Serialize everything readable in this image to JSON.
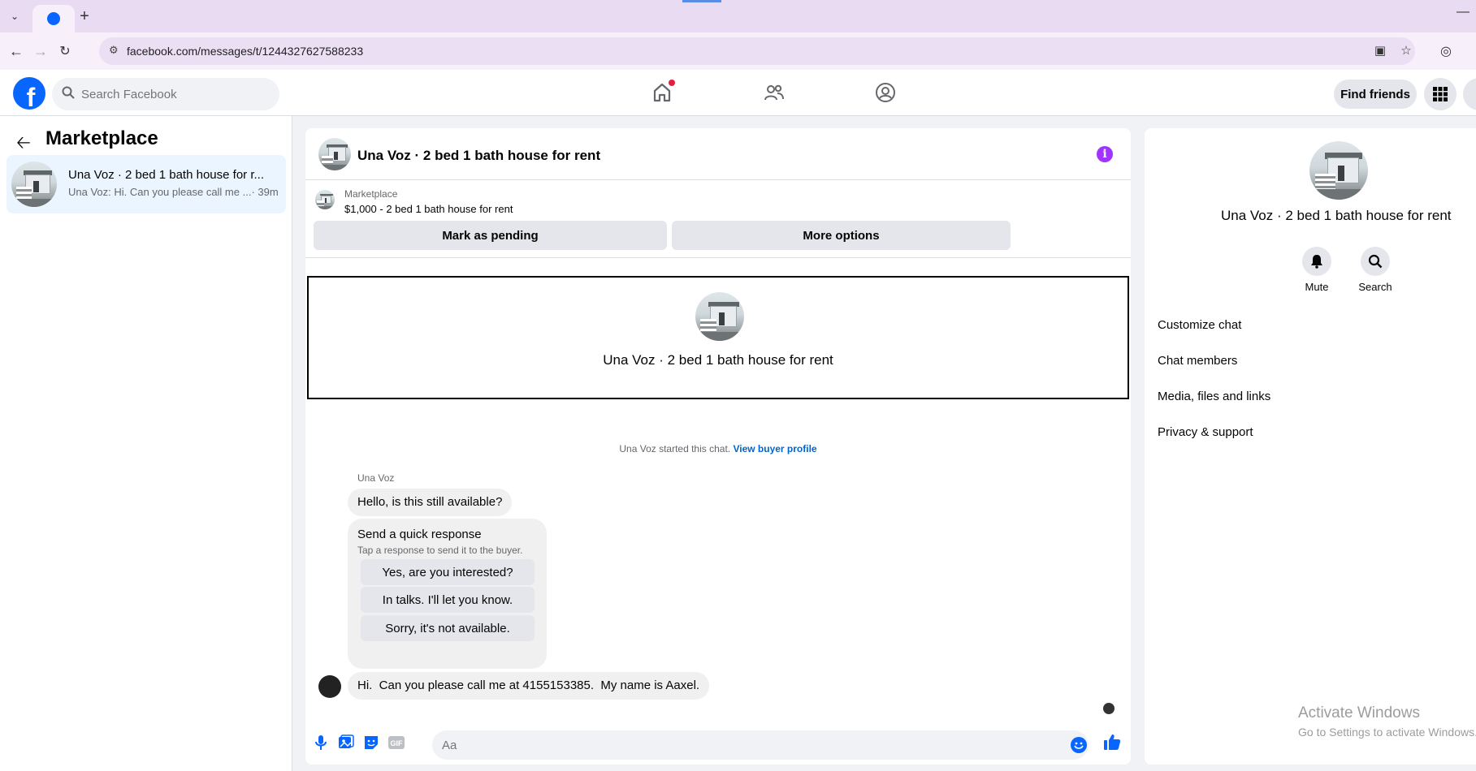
{
  "browser": {
    "url": "facebook.com/messages/t/1244327627588233"
  },
  "fb_header": {
    "search_placeholder": "Search Facebook",
    "find_friends": "Find friends"
  },
  "sidebar": {
    "title": "Marketplace",
    "conversation": {
      "name": "Una Voz · 2 bed 1 bath house for r...",
      "preview": "Una Voz: Hi.  Can you please call me ...",
      "time": "· 39m"
    }
  },
  "chat": {
    "header_title": "Una Voz · 2 bed 1 bath house for rent",
    "listing": {
      "label": "Marketplace",
      "price_title": "$1,000 - 2 bed 1 bath house for rent",
      "mark_pending": "Mark as pending",
      "more_options": "More options"
    },
    "intro_name": "Una Voz · 2 bed 1 bath house for rent",
    "started_text": "Una Voz started this chat. ",
    "started_link": "View buyer profile",
    "sender_name": "Una Voz",
    "message_1": "Hello, is this still available?",
    "quick_response": {
      "title": "Send a quick response",
      "subtitle": "Tap a response to send it to the buyer.",
      "options": [
        "Yes, are you interested?",
        "In talks. I'll let you know.",
        "Sorry, it's not available."
      ]
    },
    "message_2": "Hi.  Can you please call me at 4155153385.  My name is Aaxel.",
    "composer_placeholder": "Aa"
  },
  "info_panel": {
    "title": "Una Voz · 2 bed 1 bath house for rent",
    "actions": [
      "Mute",
      "Search"
    ],
    "menu": [
      "Customize chat",
      "Chat members",
      "Media, files and links",
      "Privacy & support"
    ]
  },
  "watermark": {
    "line1": "Activate Windows",
    "line2": "Go to Settings to activate Windows."
  },
  "colors": {
    "brand_blue": "#0866ff",
    "link_blue": "#0064d1",
    "info_purple": "#a033ff",
    "notification_red": "#e41e3f",
    "selected_conversation": "#ebf5ff"
  }
}
